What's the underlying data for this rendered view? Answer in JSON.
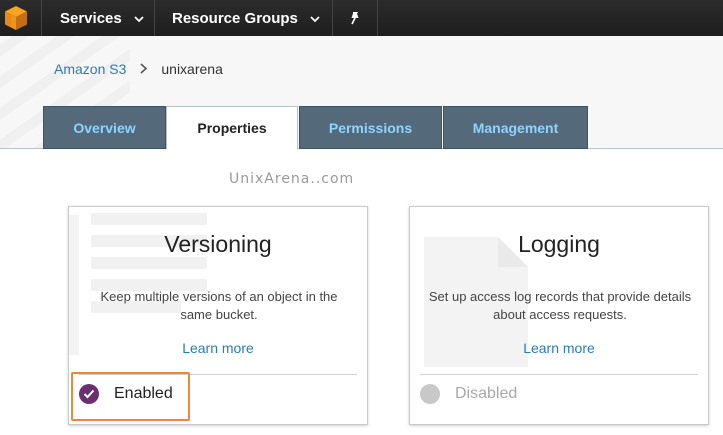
{
  "topbar": {
    "logo": "aws-cube-icon",
    "services_label": "Services",
    "resource_groups_label": "Resource Groups",
    "pin_icon": "pin-icon"
  },
  "breadcrumb": {
    "root": "Amazon S3",
    "separator_icon": "chevron-right-icon",
    "current": "unixarena"
  },
  "tabs": [
    {
      "label": "Overview",
      "active": false
    },
    {
      "label": "Properties",
      "active": true
    },
    {
      "label": "Permissions",
      "active": false
    },
    {
      "label": "Management",
      "active": false
    }
  ],
  "watermark": "UnixArena..com",
  "cards": [
    {
      "title": "Versioning",
      "description": "Keep multiple versions of an object in the same bucket.",
      "link": "Learn more",
      "status": "Enabled",
      "status_icon": "check-circle-icon"
    },
    {
      "title": "Logging",
      "description": "Set up access log records that provide details about access requests.",
      "link": "Learn more",
      "status": "Disabled",
      "status_icon": "empty-circle-icon"
    }
  ],
  "colors": {
    "topbar": "#1e1e1e",
    "tab_inactive_bg": "#546a7a",
    "tab_inactive_text": "#8fd3ff",
    "link": "#2b7bb9",
    "enabled_dot": "#6b2f6f",
    "highlight": "#e88a3c"
  }
}
